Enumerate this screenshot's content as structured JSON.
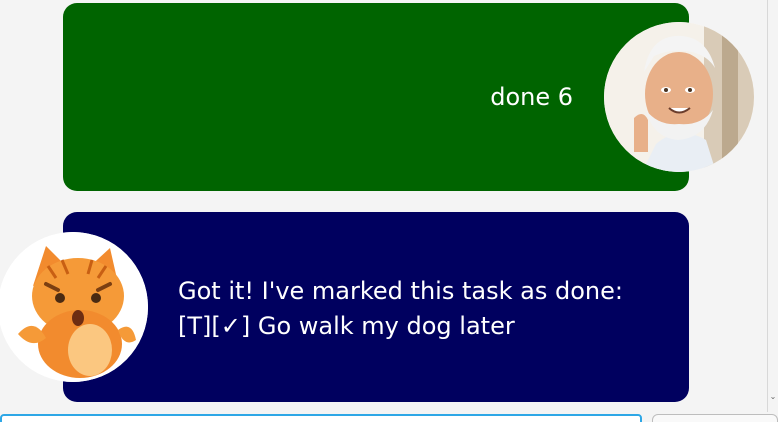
{
  "messages": [
    {
      "sender": "user",
      "avatar": "user-avatar",
      "text": "done 6"
    },
    {
      "sender": "bot",
      "avatar": "cat-avatar",
      "lines": [
        "Got it! I've marked this task as done:",
        "[T][✓] Go walk my dog later"
      ]
    }
  ],
  "input": {
    "placeholder": "",
    "value": ""
  },
  "send_button": {
    "label": ""
  },
  "colors": {
    "background": "#f4f4f4",
    "user_bubble": "#006400",
    "bot_bubble": "#00005f",
    "input_border": "#2ea7e6"
  }
}
